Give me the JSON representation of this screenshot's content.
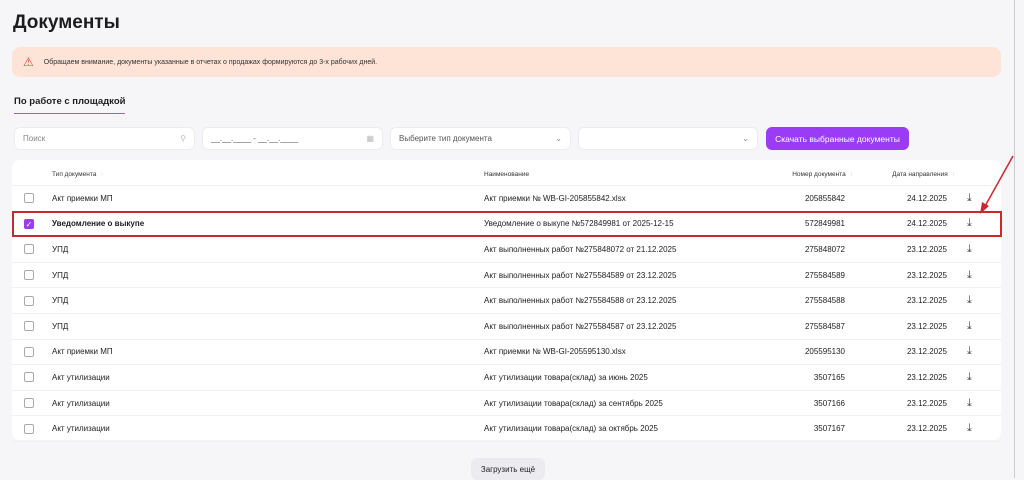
{
  "title": "Документы",
  "banner": "Обращаем внимание, документы указанные в отчетах о продажах формируются до 3-х рабочих дней.",
  "tab": "По работе с площадкой",
  "filters": {
    "search_placeholder": "Поиск",
    "date_placeholder": "__.__.____ - __.__.____",
    "type_placeholder": "Выберите тип документа",
    "second_placeholder": ""
  },
  "download_selected": "Скачать выбранные документы",
  "columns": [
    "Тип документа",
    "Наименование",
    "Номер документа",
    "Дата направления"
  ],
  "rows": [
    {
      "type": "Акт приемки МП",
      "name": "Акт приемки № WB-GI-205855842.xlsx",
      "number": "205855842",
      "date": "24.12.2025",
      "checked": false
    },
    {
      "type": "Уведомление о выкупе",
      "name": "Уведомление о выкупе №572849981 от 2025-12-15",
      "number": "572849981",
      "date": "24.12.2025",
      "checked": true
    },
    {
      "type": "УПД",
      "name": "Акт выполненных работ №275848072 от 21.12.2025",
      "number": "275848072",
      "date": "23.12.2025",
      "checked": false
    },
    {
      "type": "УПД",
      "name": "Акт выполненных работ №275584589 от 23.12.2025",
      "number": "275584589",
      "date": "23.12.2025",
      "checked": false
    },
    {
      "type": "УПД",
      "name": "Акт выполненных работ №275584588 от 23.12.2025",
      "number": "275584588",
      "date": "23.12.2025",
      "checked": false
    },
    {
      "type": "УПД",
      "name": "Акт выполненных работ №275584587 от 23.12.2025",
      "number": "275584587",
      "date": "23.12.2025",
      "checked": false
    },
    {
      "type": "Акт приемки МП",
      "name": "Акт приемки № WB-GI-205595130.xlsx",
      "number": "205595130",
      "date": "23.12.2025",
      "checked": false
    },
    {
      "type": "Акт утилизации",
      "name": "Акт утилизации товара(склад) за июнь 2025",
      "number": "3507165",
      "date": "23.12.2025",
      "checked": false
    },
    {
      "type": "Акт утилизации",
      "name": "Акт утилизации товара(склад) за сентябрь 2025",
      "number": "3507166",
      "date": "23.12.2025",
      "checked": false
    },
    {
      "type": "Акт утилизации",
      "name": "Акт утилизации товара(склад) за октябрь 2025",
      "number": "3507167",
      "date": "23.12.2025",
      "checked": false
    }
  ],
  "load_more": "Загрузить ещё"
}
